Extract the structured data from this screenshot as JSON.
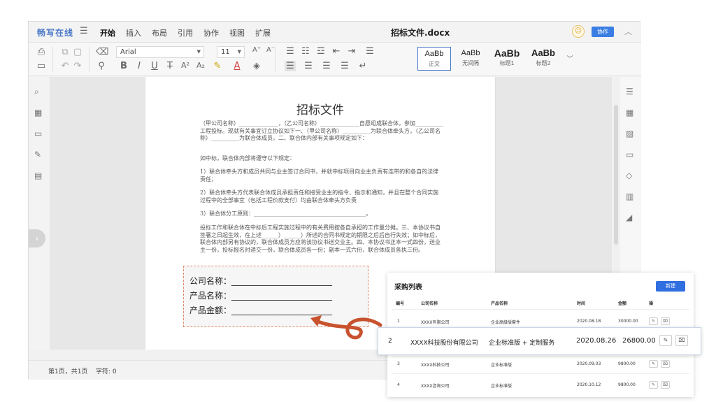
{
  "app": {
    "logo": "畅写在线",
    "menu": [
      "开始",
      "插入",
      "布局",
      "引用",
      "协作",
      "视图",
      "扩展"
    ],
    "doc_title": "招标文件.docx",
    "collab_label": "协作"
  },
  "toolbar": {
    "font": "Arial",
    "size": "11",
    "styles": [
      {
        "sample": "AaBb",
        "name": "正文"
      },
      {
        "sample": "AaBb",
        "name": "无间隔"
      },
      {
        "sample": "AaBb",
        "name": "标题1"
      },
      {
        "sample": "AaBb",
        "name": "标题2"
      }
    ]
  },
  "document": {
    "title": "招标文件",
    "paragraphs": [
      "（甲公司名称）______________，（乙公司名称）______________自愿组成联合体，参加__________工程投标。现就有关事宜订立协议如下一、（甲公司名称）__________为联合体牵头方，（乙公司名称）__________为联合体成员。二、联合体内部有关事项规定如下：",
      "如中标，联合体内部将遵守以下规定：",
      "1）联合体牵头方和成员共同与业主签订合同书，并就中标项目向业主负责有连带的和各自的法律责任；",
      "2）联合体牵头方代表联合体成员承担责任和接受业主的指令、指示和通知，并且在整个合同实施过程中的全部事宜（包括工程价款支付）均由联合体牵头方负责",
      "3）联合体分工原则：________________________________________。",
      "投标工作和联合体在中标后工程实施过程中的有关费用按各自承担的工作量分摊。三、本协议书自签署之日起生效，在上述______）______）所述的合同书规定的期限之后后自行失效；如中标后，联合体内部另有协议的，联合体成员方应将该协议书送交业主。四、本协议书正本一式四份，送业主一份，投标报名时递交一份，联合体成员各一份；副本一式六份，联合体成员各执三份。"
    ]
  },
  "status": {
    "page": "第1页，共1页",
    "words": "字符: 0"
  },
  "zoom_card": {
    "fields": [
      "公司名称：________________________",
      "产品名称：________________________",
      "产品金额：________________________"
    ]
  },
  "purchase_list": {
    "title": "采购列表",
    "new_label": "新建",
    "columns": [
      "编号",
      "公司名称",
      "产品名称",
      "时间",
      "金额",
      "操"
    ],
    "rows": [
      {
        "id": "1",
        "company": "XXXX有限公司",
        "product": "企业高级版套件",
        "date": "2020.08.18",
        "amount": "30000.00"
      },
      {
        "id": "2",
        "company": "XXXX科技股份有限公司",
        "product": "企业标准版 + 定制服务",
        "date": "2020.08.26",
        "amount": "26800.00"
      },
      {
        "id": "3",
        "company": "XXXX科技公司",
        "product": "企业标准版",
        "date": "2020.09.03",
        "amount": "9800.00"
      },
      {
        "id": "4",
        "company": "XXXX咨询公司",
        "product": "企业标准版",
        "date": "2020.10.12",
        "amount": "9800.00"
      }
    ]
  },
  "colors": {
    "accent": "#3a7ee3",
    "arrow": "#c8522e",
    "dashed": "#e08a6a"
  },
  "icons": {
    "edit": "✎",
    "delete": "🗑"
  }
}
